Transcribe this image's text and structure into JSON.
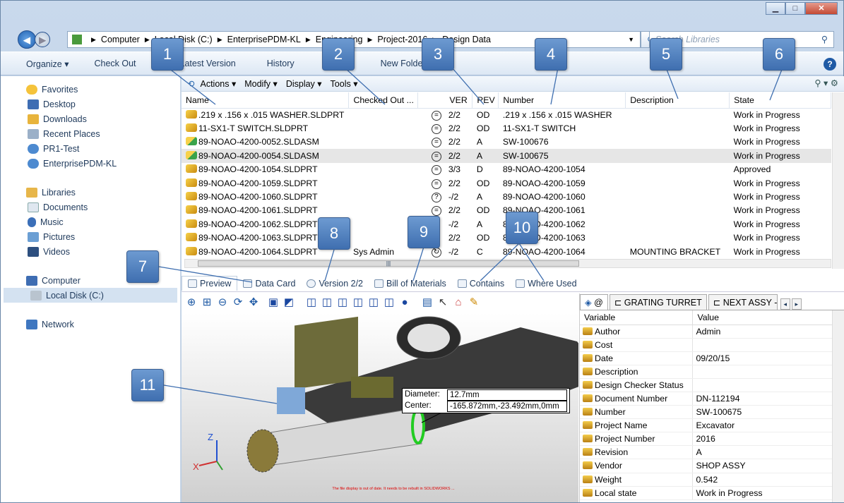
{
  "address": {
    "path": [
      "Computer",
      "Local Disk (C:)",
      "EnterprisePDM-KL",
      "Engineering",
      "Project-2016",
      "Design Data"
    ],
    "search_placeholder": "Search Libraries"
  },
  "toolbar": {
    "organize": "Organize ▾",
    "check_out": "Check Out",
    "latest_version": "Latest Version",
    "history": "History",
    "new_folder": "New Folder"
  },
  "nav": {
    "favorites": "Favorites",
    "fav_items": [
      "Desktop",
      "Downloads",
      "Recent Places",
      "PR1-Test",
      "EnterprisePDM-KL"
    ],
    "libraries": "Libraries",
    "lib_items": [
      "Documents",
      "Music",
      "Pictures",
      "Videos"
    ],
    "computer": "Computer",
    "local_disk": "Local Disk (C:)",
    "network": "Network"
  },
  "pdm_menu": [
    "Actions ▾",
    "Modify ▾",
    "Display ▾",
    "Tools ▾"
  ],
  "file_columns": [
    "Name",
    "Checked Out ...",
    "VER",
    "REV",
    "Number",
    "Description",
    "State"
  ],
  "files": [
    {
      "name": ".219 x .156 x .015  WASHER.SLDPRT",
      "type": "part",
      "checked": "",
      "stat": "=",
      "ver": "2/2",
      "rev": "OD",
      "number": ".219 x .156 x .015  WASHER",
      "desc": "",
      "state": "Work in Progress"
    },
    {
      "name": "11-SX1-T SWITCH.SLDPRT",
      "type": "part",
      "checked": "",
      "stat": "=",
      "ver": "2/2",
      "rev": "OD",
      "number": "11-SX1-T SWITCH",
      "desc": "",
      "state": "Work in Progress"
    },
    {
      "name": "89-NOAO-4200-0052.SLDASM",
      "type": "asm",
      "checked": "",
      "stat": "=",
      "ver": "2/2",
      "rev": "A",
      "number": "SW-100676",
      "desc": "",
      "state": "Work in Progress"
    },
    {
      "name": "89-NOAO-4200-0054.SLDASM",
      "type": "asm",
      "checked": "",
      "stat": "=",
      "ver": "2/2",
      "rev": "A",
      "number": "SW-100675",
      "desc": "",
      "state": "Work in Progress"
    },
    {
      "name": "89-NOAO-4200-1054.SLDPRT",
      "type": "part",
      "checked": "",
      "stat": "=",
      "ver": "3/3",
      "rev": "D",
      "number": "89-NOAO-4200-1054",
      "desc": "",
      "state": "Approved"
    },
    {
      "name": "89-NOAO-4200-1059.SLDPRT",
      "type": "part",
      "checked": "",
      "stat": "=",
      "ver": "2/2",
      "rev": "OD",
      "number": "89-NOAO-4200-1059",
      "desc": "",
      "state": "Work in Progress"
    },
    {
      "name": "89-NOAO-4200-1060.SLDPRT",
      "type": "part",
      "checked": "",
      "stat": "?",
      "ver": "-/2",
      "rev": "A",
      "number": "89-NOAO-4200-1060",
      "desc": "",
      "state": "Work in Progress"
    },
    {
      "name": "89-NOAO-4200-1061.SLDPRT",
      "type": "part",
      "checked": "",
      "stat": "=",
      "ver": "2/2",
      "rev": "OD",
      "number": "89-NOAO-4200-1061",
      "desc": "",
      "state": "Work in Progress"
    },
    {
      "name": "89-NOAO-4200-1062.SLDPRT",
      "type": "part",
      "checked": "",
      "stat": "",
      "ver": "-/2",
      "rev": "A",
      "number": "89-NOAO-4200-1062",
      "desc": "",
      "state": "Work in Progress"
    },
    {
      "name": "89-NOAO-4200-1063.SLDPRT",
      "type": "part",
      "checked": "",
      "stat": "",
      "ver": "2/2",
      "rev": "OD",
      "number": "89-NOAO-4200-1063",
      "desc": "",
      "state": "Work in Progress"
    },
    {
      "name": "89-NOAO-4200-1064.SLDPRT",
      "type": "part",
      "checked": "Sys Admin",
      "stat": "↻",
      "ver": "-/2",
      "rev": "C",
      "number": "89-NOAO-4200-1064",
      "desc": "MOUNTING BRACKET",
      "state": "Work in Progress"
    }
  ],
  "tabs": [
    "Preview",
    "Data Card",
    "Version 2/2",
    "Bill of Materials",
    "Contains",
    "Where Used"
  ],
  "measure": {
    "diameter_label": "Diameter:",
    "diameter": "12.7mm",
    "center_label": "Center:",
    "center": "-165.872mm,-23.492mm,0mm"
  },
  "preview_warning": "The file display is out of date. It needs to be rebuilt in SOLIDWORKS ...",
  "prop_tabs": [
    "@",
    "GRATING TURRET",
    "NEXT ASSY - H"
  ],
  "prop_columns": [
    "Variable",
    "Value"
  ],
  "props": [
    {
      "var": "Author",
      "val": "Admin"
    },
    {
      "var": "Cost",
      "val": ""
    },
    {
      "var": "Date",
      "val": "09/20/15"
    },
    {
      "var": "Description",
      "val": ""
    },
    {
      "var": "Design Checker Status",
      "val": ""
    },
    {
      "var": "Document Number",
      "val": "DN-112194"
    },
    {
      "var": "Number",
      "val": "SW-100675"
    },
    {
      "var": "Project Name",
      "val": "Excavator"
    },
    {
      "var": "Project Number",
      "val": "2016"
    },
    {
      "var": "Revision",
      "val": "A"
    },
    {
      "var": "Vendor",
      "val": "SHOP ASSY"
    },
    {
      "var": "Weight",
      "val": "0.542"
    },
    {
      "var": "Local state",
      "val": "Work in Progress"
    }
  ],
  "callouts": [
    "1",
    "2",
    "3",
    "4",
    "5",
    "6",
    "7",
    "8",
    "9",
    "10",
    "11"
  ],
  "colors": {
    "callout": "#4f80c0",
    "accent": "#1f5aa5"
  }
}
